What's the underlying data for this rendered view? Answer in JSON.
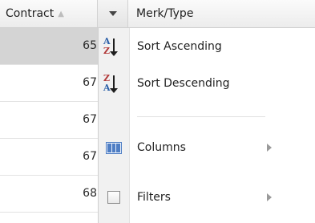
{
  "header": {
    "contract_label": "Contract",
    "sort_glyph": "▲",
    "merk_label": "Merk/Type"
  },
  "rows": [
    {
      "value": "65",
      "selected": true
    },
    {
      "value": "67"
    },
    {
      "value": "67"
    },
    {
      "value": "67"
    },
    {
      "value": "68"
    }
  ],
  "menu": {
    "items": [
      {
        "label": "Sort Ascending",
        "icon": "sort-ascending-icon",
        "letters": [
          "A",
          "Z"
        ],
        "colors": [
          "#2b5fa8",
          "#b23a3a"
        ]
      },
      {
        "label": "Sort Descending",
        "icon": "sort-descending-icon",
        "letters": [
          "Z",
          "A"
        ],
        "colors": [
          "#b23a3a",
          "#2b5fa8"
        ]
      },
      {
        "label": "Columns",
        "icon": "columns-icon",
        "submenu": true
      },
      {
        "label": "Filters",
        "icon": "filter-checkbox-icon",
        "submenu": true
      }
    ]
  }
}
